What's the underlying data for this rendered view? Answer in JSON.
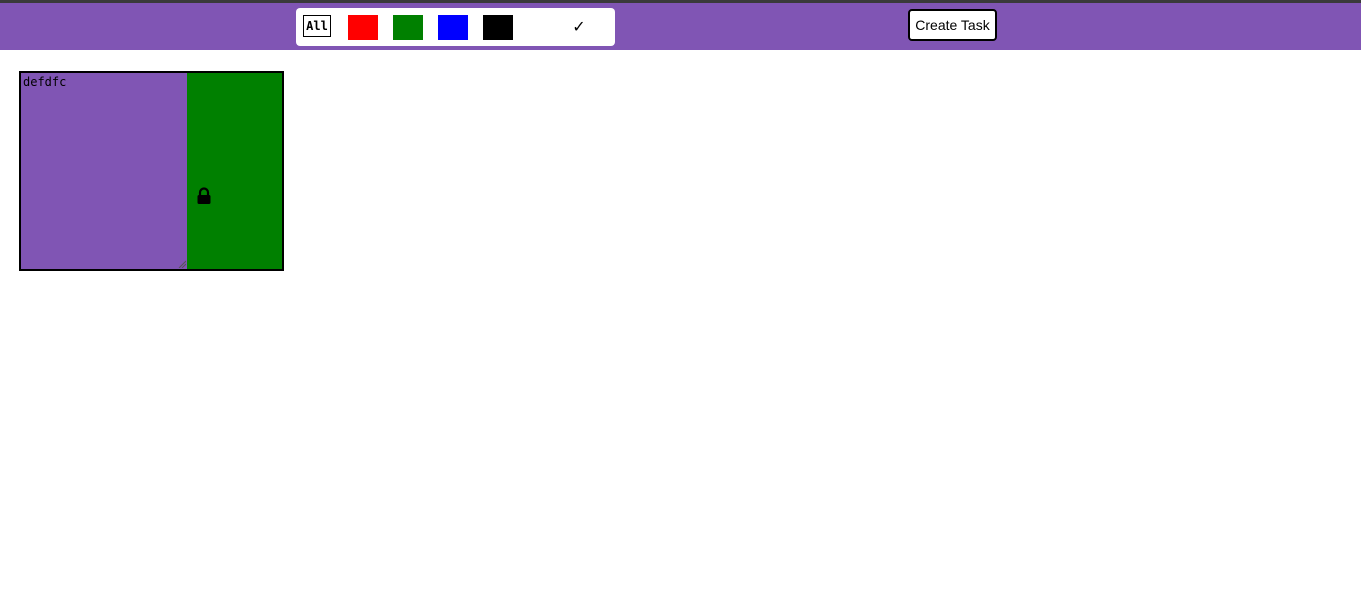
{
  "colors": {
    "toolbar_bg": "#8055b4",
    "top_line": "#3a3a3a",
    "filter_red": "#ff0000",
    "filter_green": "#008000",
    "filter_blue": "#0000ff",
    "filter_black": "#000000"
  },
  "filters": {
    "all_label": "All",
    "swatches": [
      {
        "name": "red",
        "color": "#ff0000"
      },
      {
        "name": "green",
        "color": "#008000"
      },
      {
        "name": "blue",
        "color": "#0000ff"
      },
      {
        "name": "black",
        "color": "#000000"
      }
    ],
    "check_symbol": "✓",
    "check_icon": "checkmark-icon"
  },
  "toolbar": {
    "create_task_label": "Create Task"
  },
  "tasks": [
    {
      "text": "defdfc",
      "text_bg": "#8055b4",
      "side_color": "#008000",
      "lock_icon": "lock-icon"
    }
  ]
}
